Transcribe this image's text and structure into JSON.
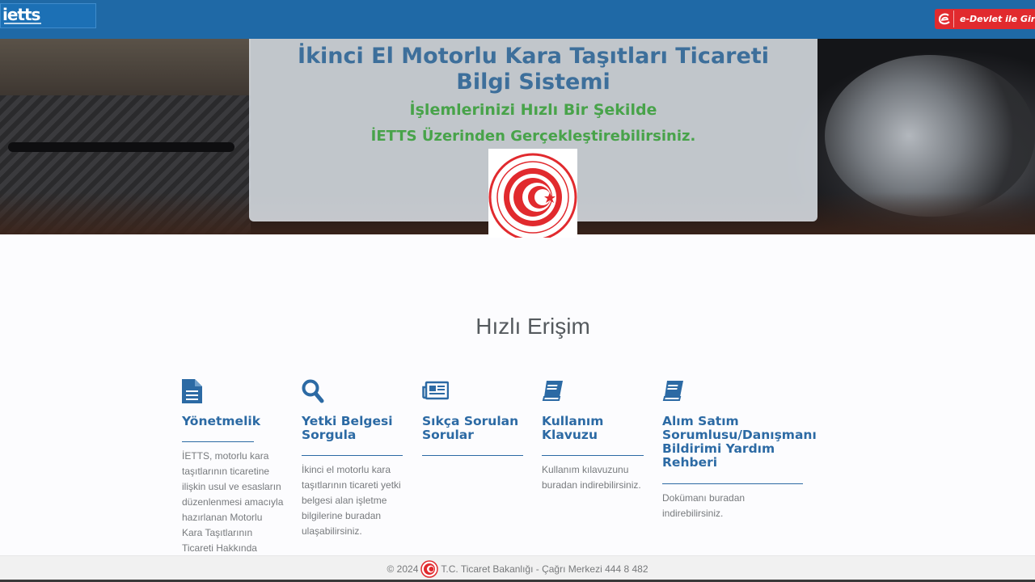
{
  "header": {
    "logo_text": "ietts",
    "edevlet_label": "e-Devlet ile Giriş"
  },
  "hero": {
    "title": "İkinci El Motorlu Kara Taşıtları Ticareti Bilgi Sistemi",
    "subtitle_line1": "İşlemlerinizi Hızlı Bir Şekilde",
    "subtitle_line2": "İETTS Üzerinden Gerçekleştirebilirsiniz."
  },
  "quick_access": {
    "title": "Hızlı Erişim",
    "cards": [
      {
        "icon": "document-icon",
        "title": "Yönetmelik",
        "text": "İETTS, motorlu kara taşıtlarının ticaretine ilişkin usul ve esasların düzenlenmesi amacıyla hazırlanan Motorlu Kara Taşıtlarının Ticareti Hakkında Yönetmelik"
      },
      {
        "icon": "search-icon",
        "title": "Yetki Belgesi Sorgula",
        "text": "İkinci el motorlu kara taşıtlarının ticareti yetki belgesi alan işletme bilgilerine buradan ulaşabilirsiniz."
      },
      {
        "icon": "newspaper-icon",
        "title": "Sıkça Sorulan Sorular",
        "text": ""
      },
      {
        "icon": "book-icon",
        "title": "Kullanım Klavuzu",
        "text": "Kullanım kılavuzunu buradan indirebilirsiniz."
      },
      {
        "icon": "book-icon",
        "title": "Alım Satım Sorumlusu/Danışmanı Bildirimi Yardım Rehberi",
        "text": "Dokümanı buradan indirebilirsiniz."
      }
    ]
  },
  "footer": {
    "copyright": "© 2024",
    "ministry": "T.C. Ticaret Bakanlığı - Çağrı Merkezi 444 8 482"
  },
  "colors": {
    "header_bg": "#1f69a6",
    "accent_blue": "#2c6aa4",
    "green": "#48a34a",
    "edevlet_red": "#e12a2e"
  }
}
